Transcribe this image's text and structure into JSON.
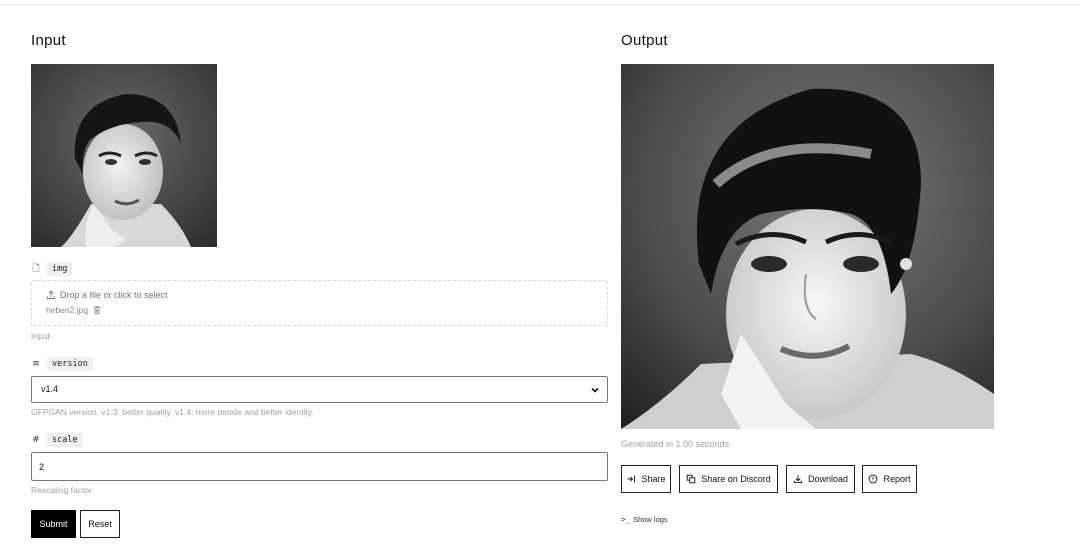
{
  "input_section": {
    "title": "Input"
  },
  "output_section": {
    "title": "Output",
    "generated_text": "Generated in 1.00 seconds",
    "actions": {
      "share": "Share",
      "discord": "Share on Discord",
      "download": "Download",
      "report": "Report"
    },
    "show_logs": "Show logs"
  },
  "fields": {
    "img": {
      "name": "img",
      "icon": "file-icon",
      "drop_hint": "Drop a file or click to select",
      "file_name": "heben2.jpg",
      "help": "Input"
    },
    "version": {
      "name": "version",
      "icon": "list-icon",
      "selected": "v1.4",
      "help": "GFPGAN version. v1.3: better quality. v1.4: more details and better identity."
    },
    "scale": {
      "name": "scale",
      "icon": "hash-icon",
      "value": "2",
      "help": "Rescaling factor"
    }
  },
  "form_actions": {
    "submit": "Submit",
    "reset": "Reset"
  },
  "colors": {
    "primary_button": "#000000",
    "help_text": "#a0a0a0"
  }
}
